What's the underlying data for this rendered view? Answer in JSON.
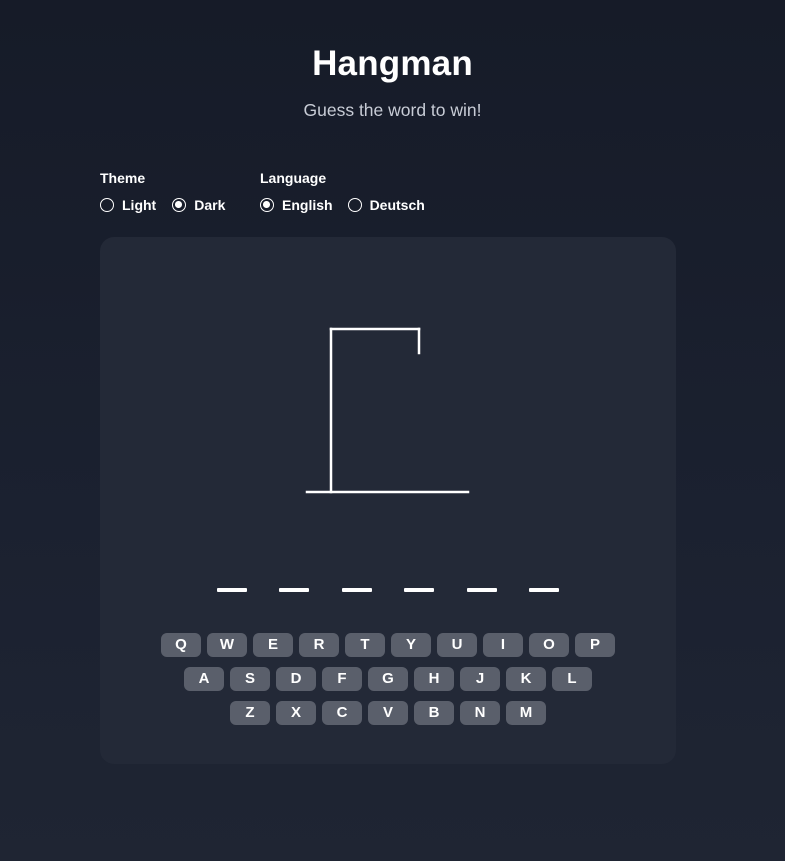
{
  "header": {
    "title": "Hangman",
    "subtitle": "Guess the word to win!"
  },
  "settings": {
    "theme": {
      "label": "Theme",
      "options": [
        {
          "label": "Light",
          "checked": false
        },
        {
          "label": "Dark",
          "checked": true
        }
      ]
    },
    "language": {
      "label": "Language",
      "options": [
        {
          "label": "English",
          "checked": true
        },
        {
          "label": "Deutsch",
          "checked": false
        }
      ]
    }
  },
  "game": {
    "word_length": 6,
    "wrong_guesses": 0,
    "keyboard": {
      "rows": [
        [
          "Q",
          "W",
          "E",
          "R",
          "T",
          "Y",
          "U",
          "I",
          "O",
          "P"
        ],
        [
          "A",
          "S",
          "D",
          "F",
          "G",
          "H",
          "J",
          "K",
          "L"
        ],
        [
          "Z",
          "X",
          "C",
          "V",
          "B",
          "N",
          "M"
        ]
      ]
    }
  },
  "colors": {
    "background": "#171c29",
    "card": "#232937",
    "key": "#5a5f6b",
    "text": "#ffffff",
    "subtitle": "#c8ccd6"
  }
}
